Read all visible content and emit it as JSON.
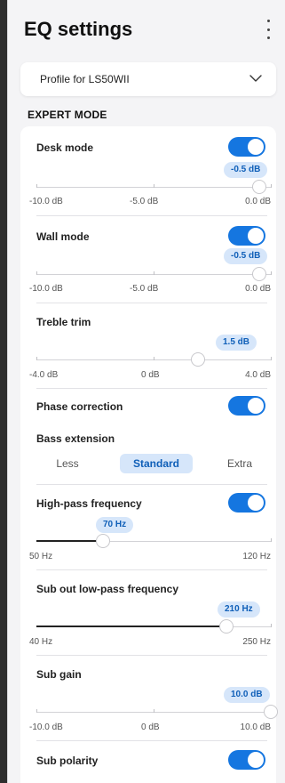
{
  "header": {
    "title": "EQ settings",
    "menu_icon": "more-vertical-icon"
  },
  "profile": {
    "label": "Profile for LS50WII",
    "icon": "chevron-down-icon"
  },
  "section": {
    "title": "EXPERT MODE"
  },
  "colors": {
    "accent": "#1576e0",
    "pill_bg": "#d6e6fa",
    "pill_text": "#0f5fb8"
  },
  "desk_mode": {
    "label": "Desk mode",
    "enabled": true,
    "value": "-0.5 dB",
    "min": -10,
    "max": 0,
    "current": -0.5,
    "scale": [
      "-10.0 dB",
      "-5.0 dB",
      "0.0 dB"
    ]
  },
  "wall_mode": {
    "label": "Wall mode",
    "enabled": true,
    "value": "-0.5 dB",
    "min": -10,
    "max": 0,
    "current": -0.5,
    "scale": [
      "-10.0 dB",
      "-5.0 dB",
      "0.0 dB"
    ]
  },
  "treble_trim": {
    "label": "Treble trim",
    "value": "1.5 dB",
    "min": -4,
    "max": 4,
    "current": 1.5,
    "scale": [
      "-4.0 dB",
      "0 dB",
      "4.0 dB"
    ]
  },
  "phase_correction": {
    "label": "Phase correction",
    "enabled": true
  },
  "bass_extension": {
    "label": "Bass extension",
    "options": [
      "Less",
      "Standard",
      "Extra"
    ],
    "selected": "Standard"
  },
  "high_pass": {
    "label": "High-pass frequency",
    "enabled": true,
    "value": "70 Hz",
    "min": 50,
    "max": 120,
    "current": 70,
    "scale": [
      "50 Hz",
      "120 Hz"
    ]
  },
  "sub_lowpass": {
    "label": "Sub out low-pass frequency",
    "value": "210 Hz",
    "min": 40,
    "max": 250,
    "current": 210,
    "scale": [
      "40 Hz",
      "250 Hz"
    ]
  },
  "sub_gain": {
    "label": "Sub gain",
    "value": "10.0 dB",
    "min": -10,
    "max": 10,
    "current": 10,
    "scale": [
      "-10.0 dB",
      "0 dB",
      "10.0 dB"
    ]
  },
  "sub_polarity": {
    "label": "Sub polarity",
    "enabled": true
  }
}
